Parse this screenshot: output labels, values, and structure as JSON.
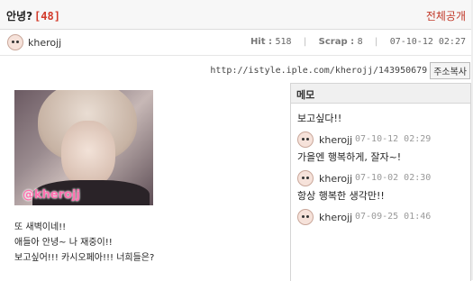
{
  "post": {
    "title": "안녕?",
    "count": "[48]",
    "visibility": "전체공개",
    "author": "kherojj",
    "hit_label": "Hit",
    "hit_value": "518",
    "scrap_label": "Scrap",
    "scrap_value": "8",
    "datetime": "07-10-12 02:27",
    "url": "http://istyle.iple.com/kherojj/143950679",
    "copy_button": "주소복사",
    "image_watermark": "@kherojj",
    "body_lines": [
      "또 새벽이네!!",
      "애들아 안녕~ 나 재중이!!",
      "보고싶어!!! 카시오페아!!! 너희들은?"
    ]
  },
  "memo": {
    "title": "메모",
    "items": [
      {
        "text": "보고싶다!!",
        "user": "kherojj",
        "date": "07-10-12 02:29"
      },
      {
        "text": "가을엔 행복하게, 잘자~!",
        "user": "kherojj",
        "date": "07-10-02 02:30"
      },
      {
        "text": "항상 행복한 생각만!!",
        "user": "kherojj",
        "date": "07-09-25 01:46"
      }
    ]
  }
}
